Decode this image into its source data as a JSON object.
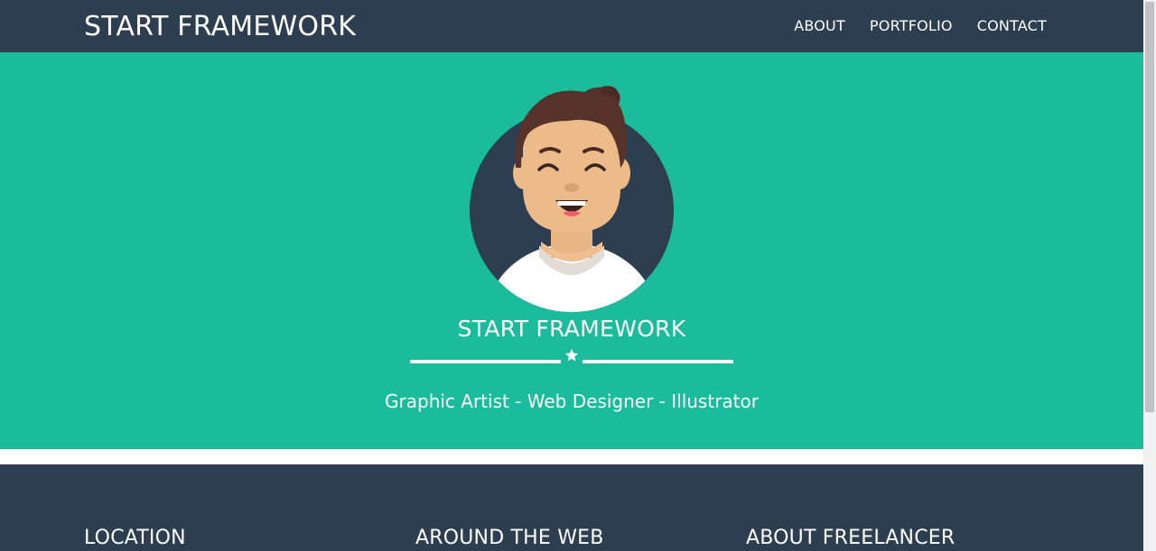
{
  "navbar": {
    "brand": "START FRAMEWORK",
    "links": [
      {
        "label": "ABOUT"
      },
      {
        "label": "PORTFOLIO"
      },
      {
        "label": "CONTACT"
      }
    ]
  },
  "hero": {
    "title": "START FRAMEWORK",
    "subtitle": "Graphic Artist - Web Designer - Illustrator",
    "divider_icon": "star-icon",
    "avatar_icon": "avatar-illustration"
  },
  "footer": {
    "headings": [
      "LOCATION",
      "AROUND THE WEB",
      "ABOUT FREELANCER"
    ]
  },
  "colors": {
    "navbar": "#2c3e50",
    "hero": "#1abc9c",
    "footer": "#2c3e50",
    "text": "#ffffff"
  }
}
